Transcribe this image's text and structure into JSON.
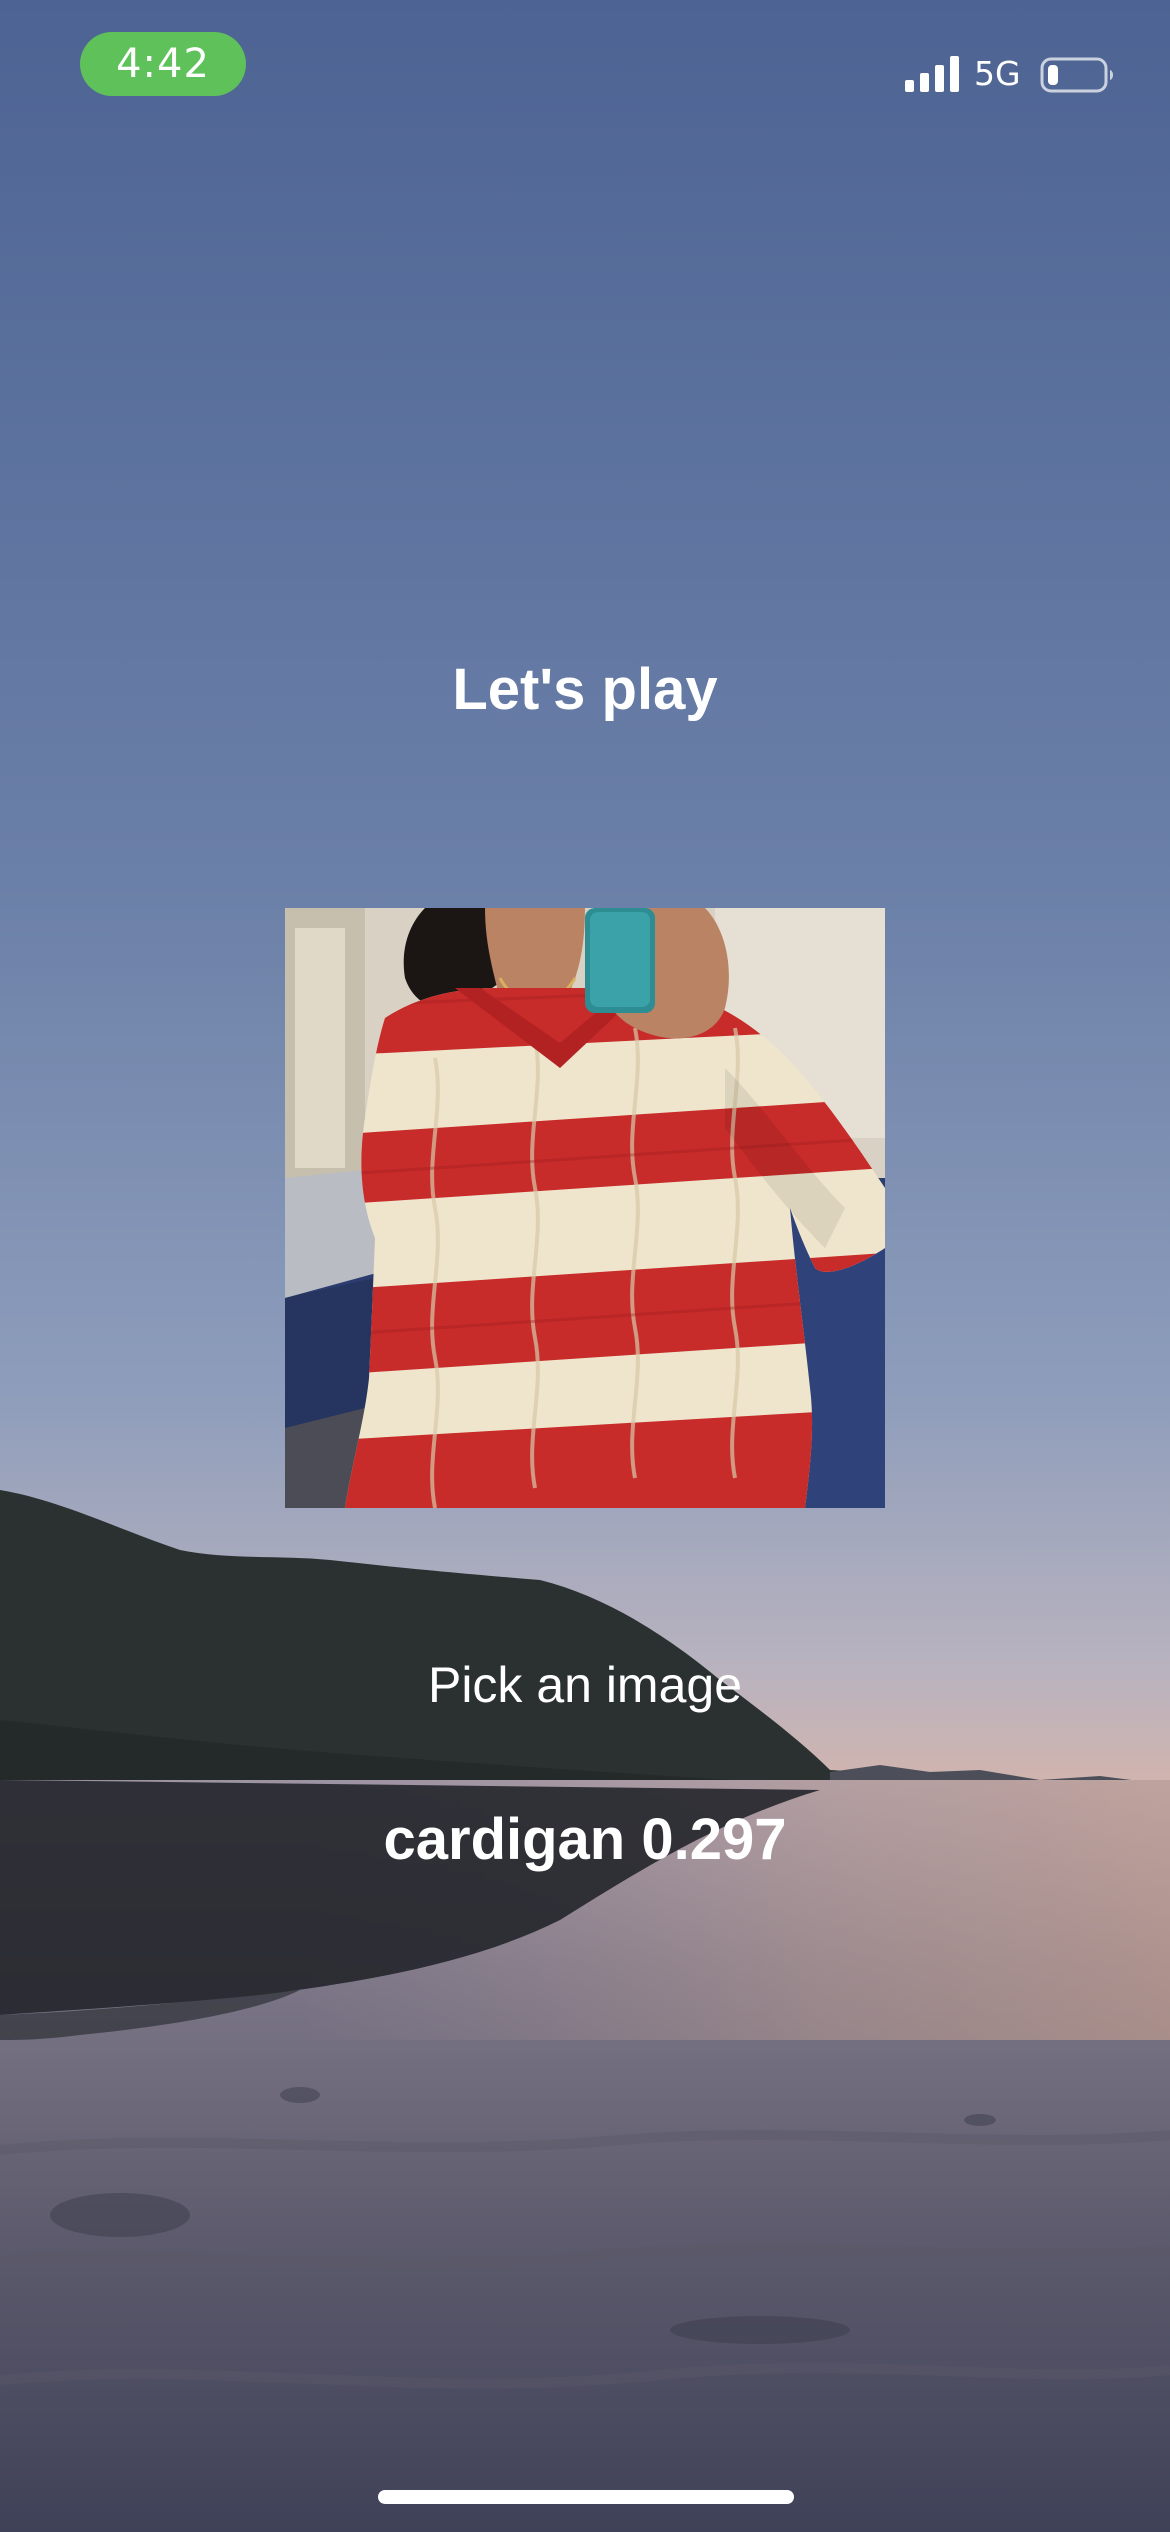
{
  "status_bar": {
    "time": "4:42",
    "network": "5G",
    "time_pill_color": "#5fc15a",
    "battery_level": 0.2
  },
  "main": {
    "title": "Let's play",
    "pick_label": "Pick an image",
    "result_label": "cardigan",
    "result_score": "0.297"
  },
  "photo": {
    "subject": "person in red and cream striped cable-knit sweater taking mirror selfie"
  }
}
